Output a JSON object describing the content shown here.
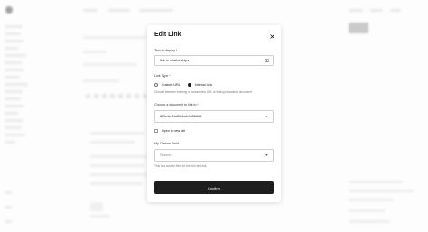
{
  "modal": {
    "title": "Edit Link",
    "text_to_display": {
      "label": "Text to display",
      "required": "*",
      "value": "link to relationships"
    },
    "link_type": {
      "label": "Link Type",
      "required": "*",
      "options": [
        {
          "label": "Custom URL",
          "selected": false
        },
        {
          "label": "Internal Link",
          "selected": true
        }
      ],
      "help": "Choose between entering a custom new URL or linking to another document."
    },
    "document": {
      "label": "Choose a document to link to",
      "required": "*",
      "value": "825e4ef1fa5f04afc9636663"
    },
    "open_new_tab": {
      "label": "Open in new tab",
      "checked": false
    },
    "custom_field": {
      "label": "My Custom Field",
      "placeholder": "Search...",
      "help": "This is a custom field for the rich text link."
    },
    "confirm_label": "Confirm"
  },
  "colors": {
    "primary_button": "#1e1e1e",
    "required": "#c0392b"
  }
}
